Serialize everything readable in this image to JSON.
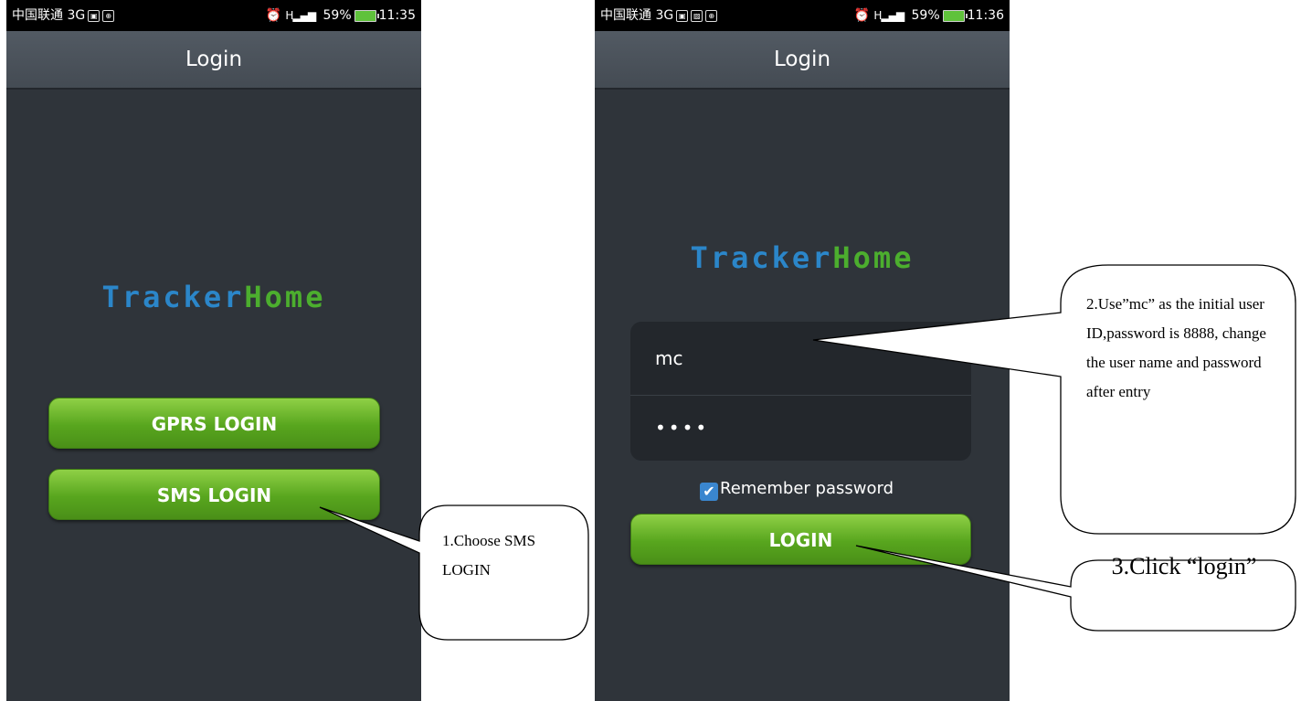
{
  "left_screen": {
    "status": {
      "carrier": "中国联通 3G",
      "network": "H",
      "battery": "59%",
      "time": "11:35"
    },
    "title": "Login",
    "logo": {
      "part1": "Tracker",
      "part2": "Home"
    },
    "buttons": {
      "gprs": "GPRS LOGIN",
      "sms": "SMS LOGIN"
    }
  },
  "right_screen": {
    "status": {
      "carrier": "中国联通 3G",
      "network": "H",
      "battery": "59%",
      "time": "11:36"
    },
    "title": "Login",
    "logo": {
      "part1": "Tracker",
      "part2": "Home"
    },
    "username_value": "mc",
    "password_value": "••••",
    "remember_label": "Remember password",
    "remember_checked": true,
    "login_button": "LOGIN"
  },
  "callouts": {
    "step1": "1.Choose SMS LOGIN",
    "step2": "2.Use”mc” as the initial user ID,password is 8888, change the user name and password after entry",
    "step3": "3.Click “login”"
  },
  "colors": {
    "logo_blue": "#2b86c9",
    "logo_green": "#4cae2e",
    "button_green": "#58a61e",
    "checkbox_blue": "#3a86cf"
  }
}
